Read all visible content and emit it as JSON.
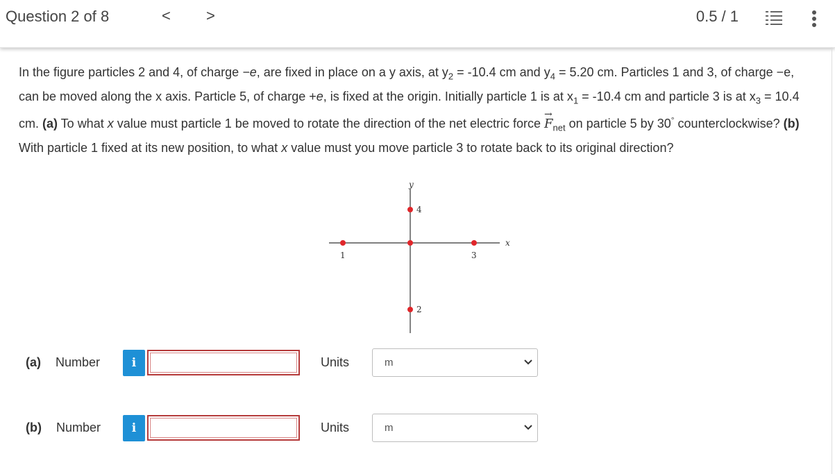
{
  "header": {
    "question_title": "Question 2 of 8",
    "prev_label": "<",
    "next_label": ">",
    "score": "0.5 / 1"
  },
  "question": {
    "p1": "In the figure particles 2 and 4, of charge ",
    "charge_neg_e": "−e",
    "p2": ", are fixed in place on a y axis, at y",
    "y2_sub": "2",
    "p3": " = -10.4 cm and y",
    "y4_sub": "4",
    "p4": " = 5.20 cm. Particles 1 and 3, of charge −e, can be moved along the x axis. Particle 5, of charge +",
    "charge_e": "e",
    "p5": ", is fixed at the origin. Initially particle 1 is at x",
    "x1_sub": "1",
    "p6": " = -10.4 cm and particle 3 is at x",
    "x3_sub": "3",
    "p7": " = 10.4 cm. ",
    "part_a_tag": "(a)",
    "p8": " To what ",
    "x_var": "x",
    "p9": " value must particle 1 be moved to rotate the direction of the net electric force ",
    "F_symbol": "F",
    "net_sub": "net",
    "p10": " on particle 5 by 30",
    "deg": "°",
    "p11": " counterclockwise? ",
    "part_b_tag": "(b)",
    "p12": " With particle 1 fixed at its new position, to what ",
    "x_var2": "x",
    "p13": " value must you move particle 3 to rotate back to its original direction?"
  },
  "figure": {
    "y_axis_label": "y",
    "x_axis_label": "x",
    "particle_labels": {
      "p1": "1",
      "p2": "2",
      "p3": "3",
      "p4": "4"
    },
    "particle_color": "#e0262a"
  },
  "answers": {
    "a": {
      "part_label": "(a)",
      "number_label": "Number",
      "info_icon": "i",
      "units_label": "Units",
      "unit_value": "m",
      "input_value": ""
    },
    "b": {
      "part_label": "(b)",
      "number_label": "Number",
      "info_icon": "i",
      "units_label": "Units",
      "unit_value": "m",
      "input_value": ""
    }
  },
  "colors": {
    "info_button": "#1e90d6",
    "input_border_error": "#b53a3a"
  }
}
